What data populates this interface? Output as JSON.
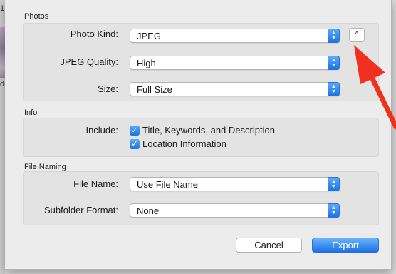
{
  "background": {
    "text1": "1",
    "text2": "di"
  },
  "photos": {
    "title": "Photos",
    "photo_kind": {
      "label": "Photo Kind:",
      "value": "JPEG"
    },
    "jpeg_quality": {
      "label": "JPEG Quality:",
      "value": "High"
    },
    "size": {
      "label": "Size:",
      "value": "Full Size"
    },
    "disclosure_icon": "^"
  },
  "info": {
    "title": "Info",
    "include_label": "Include:",
    "options": [
      {
        "label": "Title, Keywords, and Description",
        "checked": true
      },
      {
        "label": "Location Information",
        "checked": true
      }
    ]
  },
  "file_naming": {
    "title": "File Naming",
    "file_name": {
      "label": "File Name:",
      "value": "Use File Name"
    },
    "subfolder_format": {
      "label": "Subfolder Format:",
      "value": "None"
    }
  },
  "buttons": {
    "cancel": "Cancel",
    "export": "Export"
  },
  "annotation": {
    "arrow_color": "#f0311f"
  },
  "colors": {
    "accent": "#1d74e4"
  }
}
